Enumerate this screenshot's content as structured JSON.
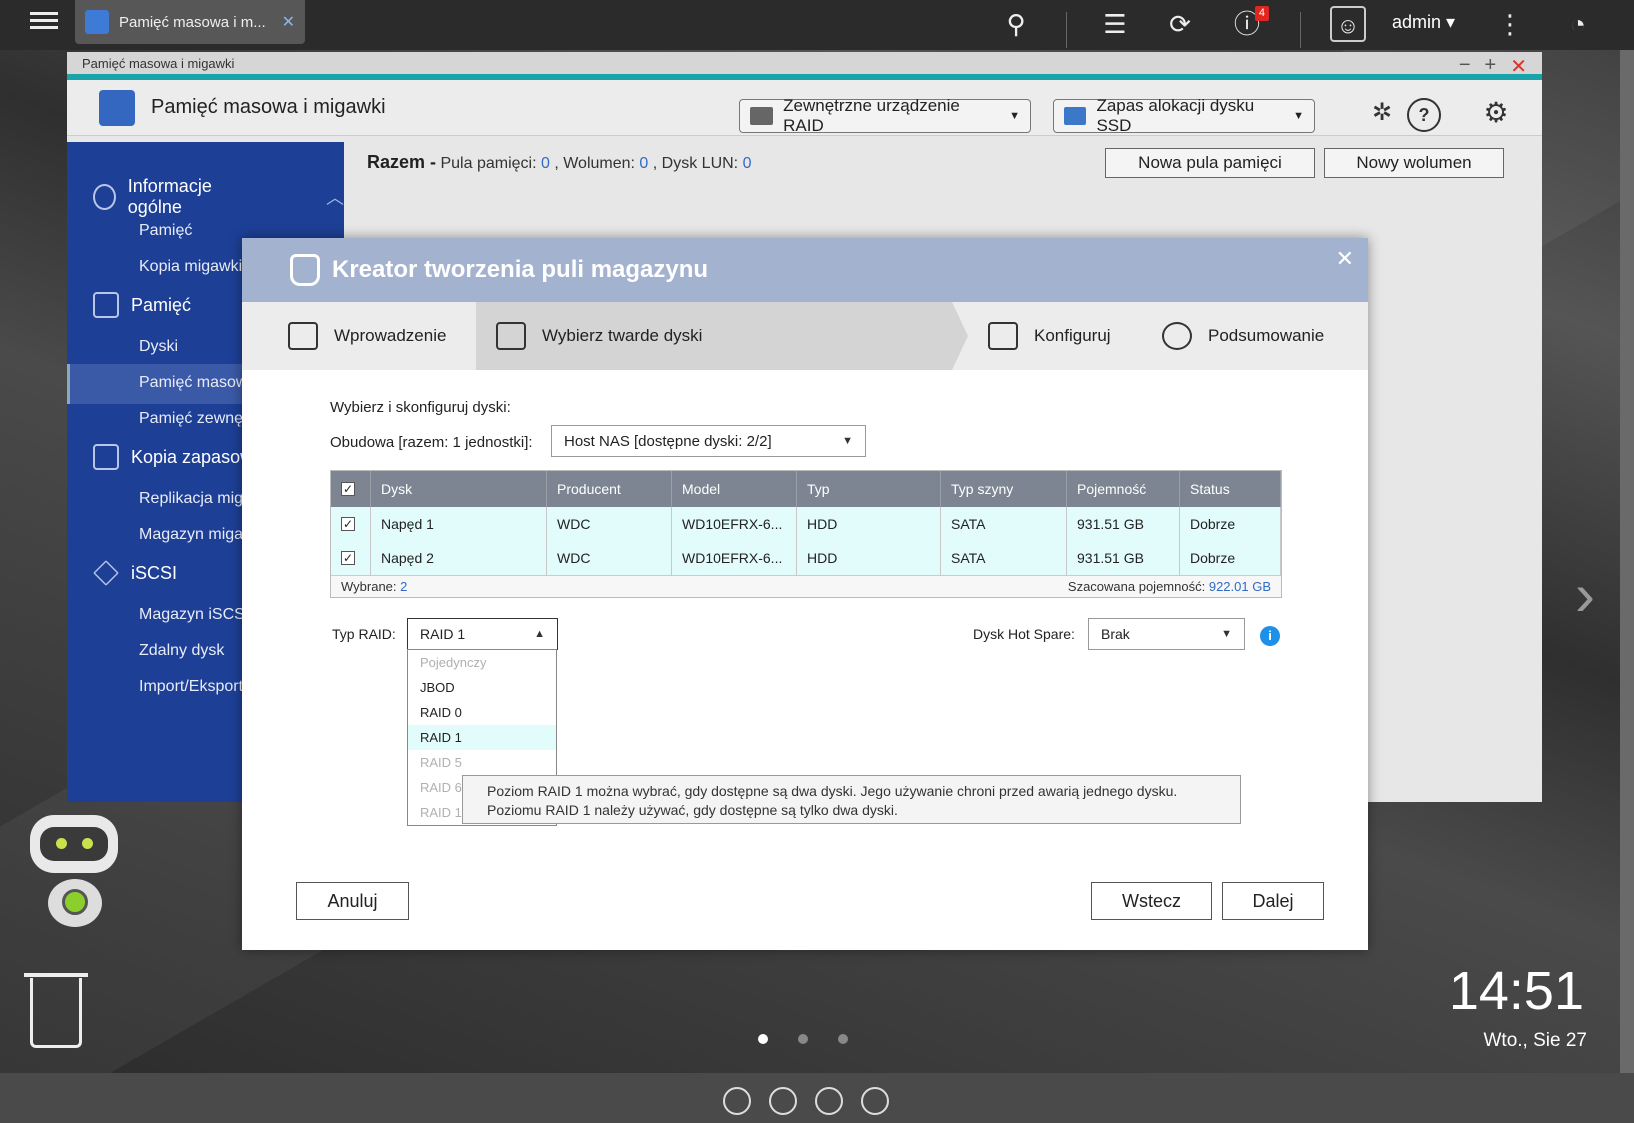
{
  "topbar": {
    "tab_title": "Pamięć masowa i m...",
    "tab_close": "✕",
    "user": "admin ▾",
    "notification_count": "4"
  },
  "window": {
    "titlebar": "Pamięć masowa i migawki",
    "title": "Pamięć masowa i migawki",
    "dropdown_raid": "Zewnętrzne urządzenie RAID",
    "dropdown_ssd": "Zapas alokacji dysku SSD",
    "summary_label": "Razem -",
    "summary_pool_label": "Pula pamięci:",
    "summary_pool": "0",
    "summary_volume_label": ", Wolumen:",
    "summary_volume": "0",
    "summary_lun_label": ", Dysk LUN:",
    "summary_lun": "0",
    "btn_new_pool": "Nowa pula pamięci",
    "btn_new_volume": "Nowy wolumen"
  },
  "sidebar": {
    "section1": "Informacje ogólne",
    "item1": "Pamięć",
    "item2": "Kopia migawki",
    "section2": "Pamięć",
    "item3": "Dyski",
    "item4": "Pamięć masowa",
    "item5": "Pamięć zewnętrzna",
    "section3": "Kopia zapasowa",
    "item6": "Replikacja migawek",
    "item7": "Magazyn migawek",
    "section4": "iSCSI",
    "item8": "Magazyn iSCSI",
    "item9": "Zdalny dysk",
    "item10": "Import/Eksport"
  },
  "modal": {
    "title": "Kreator tworzenia puli magazynu",
    "close": "✕",
    "steps": [
      "Wprowadzenie",
      "Wybierz twarde dyski",
      "Konfiguruj",
      "Podsumowanie"
    ],
    "instruction": "Wybierz i skonfiguruj dyski:",
    "enclosure_label": "Obudowa [razem: 1 jednostki]:",
    "enclosure_value": "Host NAS [dostępne dyski: 2/2]",
    "table": {
      "headers": [
        "Dysk",
        "Producent",
        "Model",
        "Typ",
        "Typ szyny",
        "Pojemność",
        "Status"
      ],
      "rows": [
        [
          "Napęd 1",
          "WDC",
          "WD10EFRX-6...",
          "HDD",
          "SATA",
          "931.51 GB",
          "Dobrze"
        ],
        [
          "Napęd 2",
          "WDC",
          "WD10EFRX-6...",
          "HDD",
          "SATA",
          "931.51 GB",
          "Dobrze"
        ]
      ],
      "selected_label": "Wybrane:",
      "selected_value": "2",
      "capacity_label": "Szacowana pojemność:",
      "capacity_value": "922.01 GB"
    },
    "raid_label": "Typ RAID:",
    "raid_value": "RAID 1",
    "raid_options": [
      "Pojedynczy",
      "JBOD",
      "RAID 0",
      "RAID 1",
      "RAID 5",
      "RAID 6",
      "RAID 10"
    ],
    "hotspare_label": "Dysk Hot Spare:",
    "hotspare_value": "Brak",
    "tooltip_line1": "Poziom RAID 1 można wybrać, gdy dostępne są dwa dyski. Jego używanie chroni przed awarią jednego dysku.",
    "tooltip_line2": "Poziomu RAID 1 należy używać, gdy dostępne są tylko dwa dyski.",
    "btn_cancel": "Anuluj",
    "btn_back": "Wstecz",
    "btn_next": "Dalej"
  },
  "desktop": {
    "clock": "14:51",
    "date": "Wto., Sie 27"
  }
}
